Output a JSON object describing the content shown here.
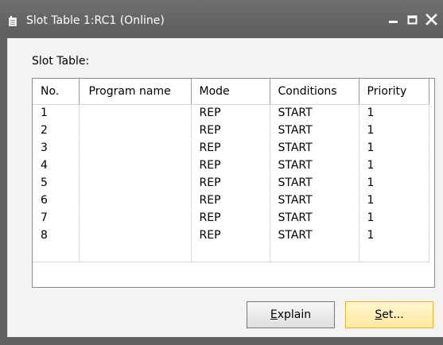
{
  "window": {
    "title": "Slot Table 1:RC1 (Online)"
  },
  "section": {
    "label": "Slot Table:"
  },
  "table": {
    "columns": [
      "No.",
      "Program name",
      "Mode",
      "Conditions",
      "Priority"
    ],
    "rows": [
      {
        "no": "1",
        "program": "",
        "mode": "REP",
        "conditions": "START",
        "priority": "1"
      },
      {
        "no": "2",
        "program": "",
        "mode": "REP",
        "conditions": "START",
        "priority": "1"
      },
      {
        "no": "3",
        "program": "",
        "mode": "REP",
        "conditions": "START",
        "priority": "1"
      },
      {
        "no": "4",
        "program": "",
        "mode": "REP",
        "conditions": "START",
        "priority": "1"
      },
      {
        "no": "5",
        "program": "",
        "mode": "REP",
        "conditions": "START",
        "priority": "1"
      },
      {
        "no": "6",
        "program": "",
        "mode": "REP",
        "conditions": "START",
        "priority": "1"
      },
      {
        "no": "7",
        "program": "",
        "mode": "REP",
        "conditions": "START",
        "priority": "1"
      },
      {
        "no": "8",
        "program": "",
        "mode": "REP",
        "conditions": "START",
        "priority": "1"
      }
    ]
  },
  "buttons": {
    "explain": {
      "mnemonic": "E",
      "rest": "xplain"
    },
    "set": {
      "mnemonic": "S",
      "rest": "et..."
    }
  },
  "icons": {
    "title": "document-icon",
    "minimize": "minimize-icon",
    "maximize": "maximize-icon",
    "close": "close-icon"
  },
  "colors": {
    "titlebar": "#626262",
    "client_bg": "#f3f3f3",
    "default_button": "#ffe9a0"
  }
}
